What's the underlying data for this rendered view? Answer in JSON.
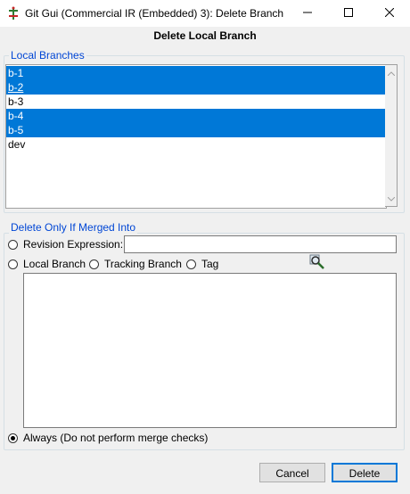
{
  "window": {
    "title": "Git Gui (Commercial IR (Embedded) 3): Delete Branch",
    "icons": [
      "git-app-icon",
      "minimize-icon",
      "maximize-icon",
      "close-icon"
    ]
  },
  "heading": "Delete Local Branch",
  "local_branches": {
    "group_label": "Local Branches",
    "items": [
      {
        "label": "b-1",
        "selected": true
      },
      {
        "label": "b-2",
        "selected": true
      },
      {
        "label": "b-3",
        "selected": false
      },
      {
        "label": "b-4",
        "selected": true
      },
      {
        "label": "b-5",
        "selected": true
      },
      {
        "label": "dev",
        "selected": false
      }
    ]
  },
  "merge_check": {
    "group_label": "Delete Only If Merged Into",
    "revision_expression_label": "Revision Expression:",
    "revision_expression_value": "",
    "local_branch_label": "Local Branch",
    "tracking_branch_label": "Tracking Branch",
    "tag_label": "Tag",
    "always_label": "Always (Do not perform merge checks)",
    "selected_option": "always"
  },
  "buttons": {
    "cancel": "Cancel",
    "delete": "Delete"
  },
  "colors": {
    "selection": "#0078d7",
    "group_label": "#0046d5",
    "window_bg": "#f0f0f0"
  }
}
